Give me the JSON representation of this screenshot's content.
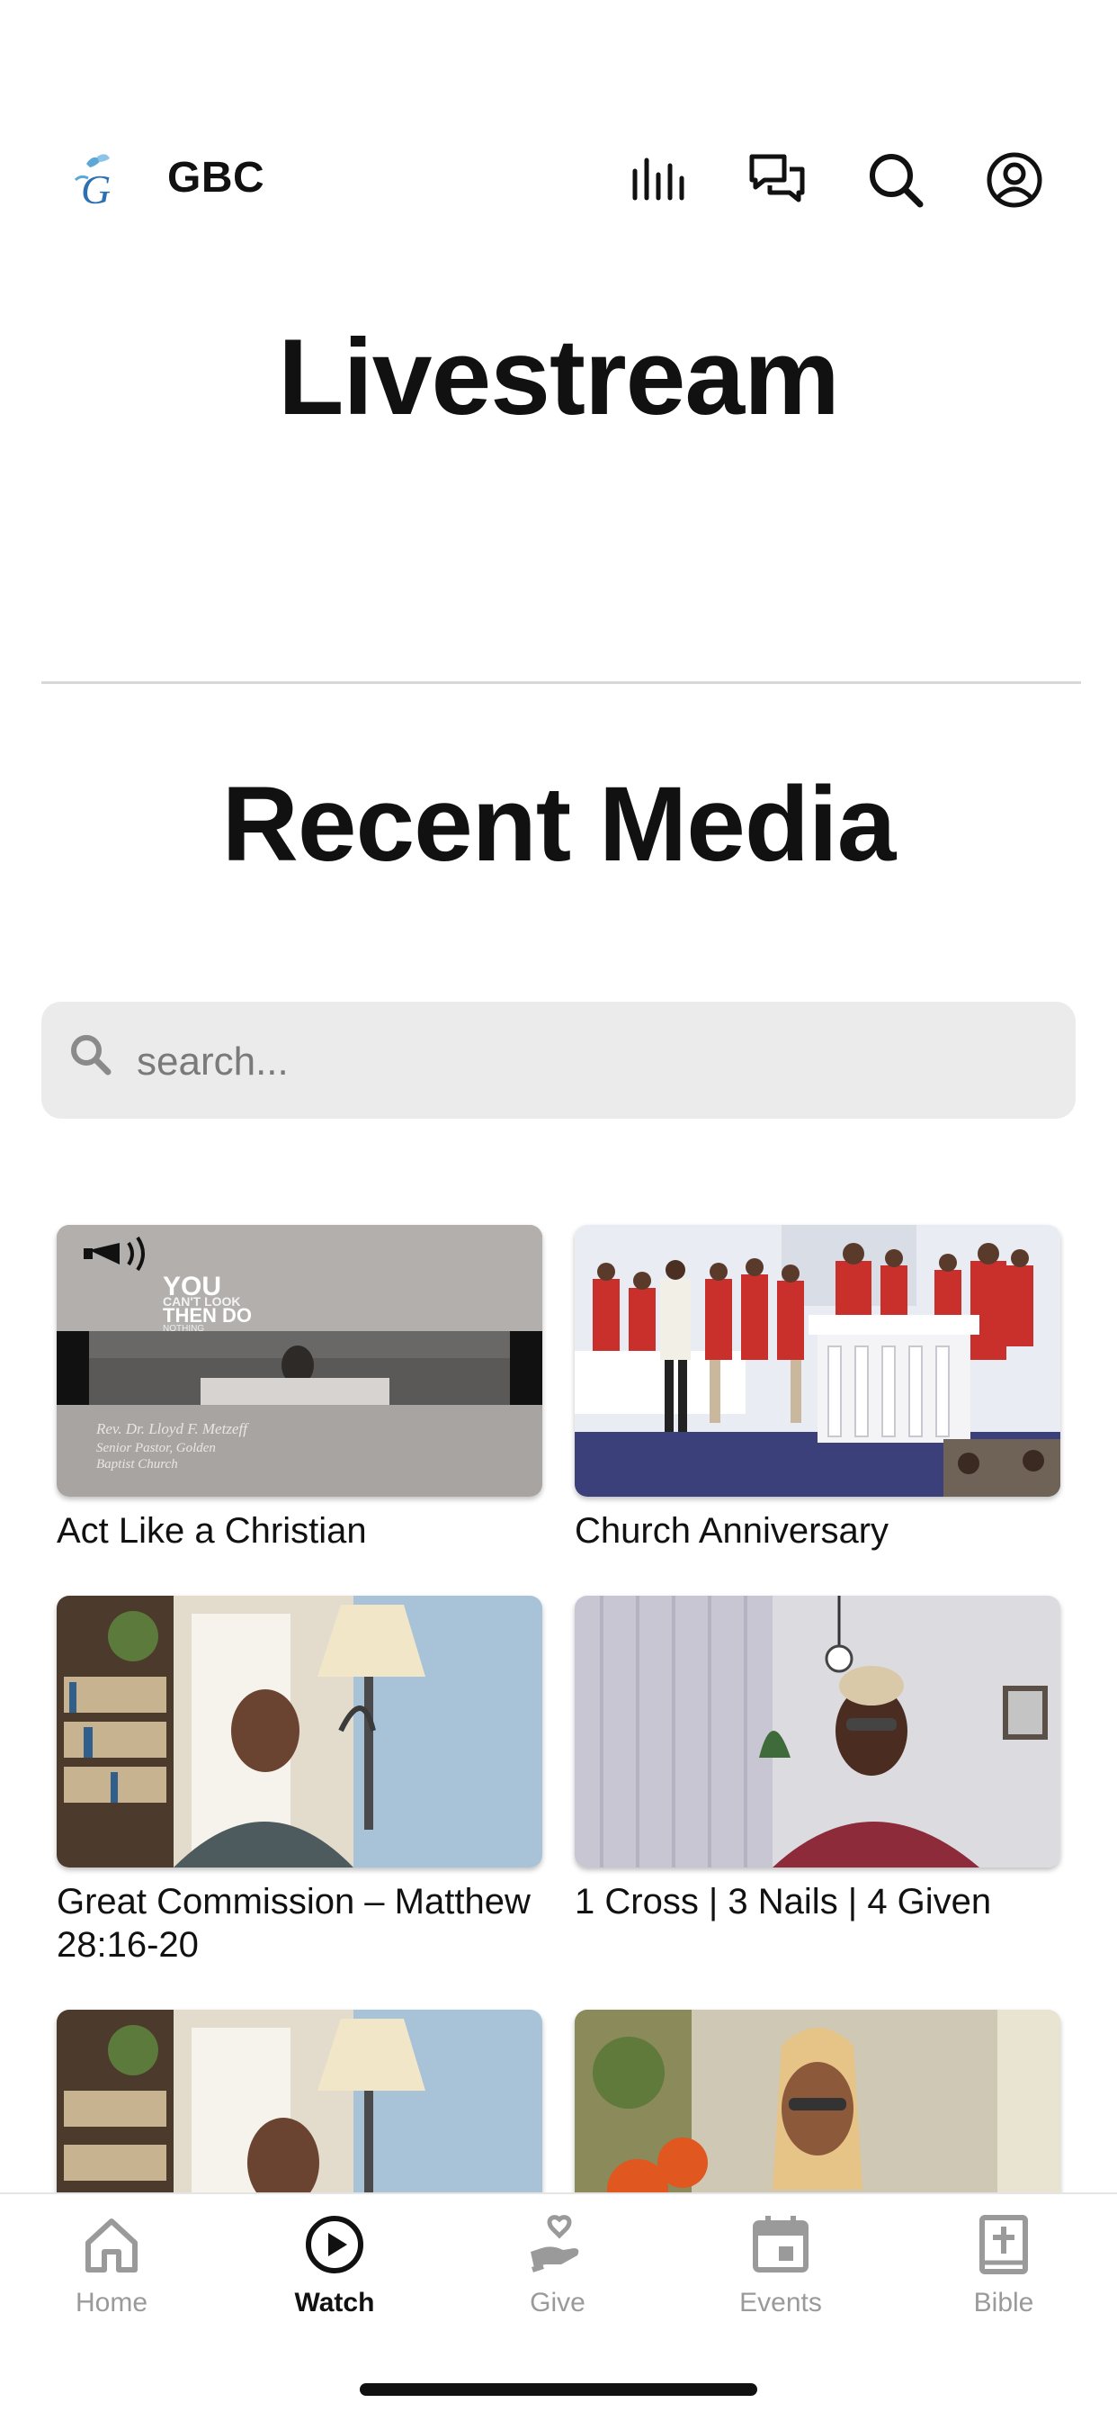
{
  "header": {
    "brand": "GBC",
    "icons": [
      "equalizer-icon",
      "chat-bubbles-icon",
      "search-icon",
      "account-icon"
    ]
  },
  "page_title": "Livestream",
  "section_title": "Recent Media",
  "search": {
    "placeholder": "search..."
  },
  "media": [
    {
      "title": "Act Like a Christian"
    },
    {
      "title": "Church Anniversary"
    },
    {
      "title": "Great Commission – Matthew 28:16-20"
    },
    {
      "title": "1 Cross | 3 Nails | 4 Given"
    },
    {
      "title": ""
    },
    {
      "title": ""
    }
  ],
  "thumb1_text": {
    "line1": "YOU",
    "line2": "CAN'T LOOK",
    "line3": "THEN DO",
    "line4": "NOTHING",
    "caption1": "Rev. Dr. Lloyd F. Metzeff",
    "caption2": "Senior Pastor, Golden",
    "caption3": "Baptist Church"
  },
  "tabbar": {
    "tabs": [
      {
        "label": "Home"
      },
      {
        "label": "Watch"
      },
      {
        "label": "Give"
      },
      {
        "label": "Events"
      },
      {
        "label": "Bible"
      }
    ],
    "active_tab": "Watch"
  },
  "colors": {
    "accent": "#111111",
    "inactive": "#9a9a9a",
    "search_bg": "#ebebeb",
    "logo_blue": "#3a7fc1"
  }
}
